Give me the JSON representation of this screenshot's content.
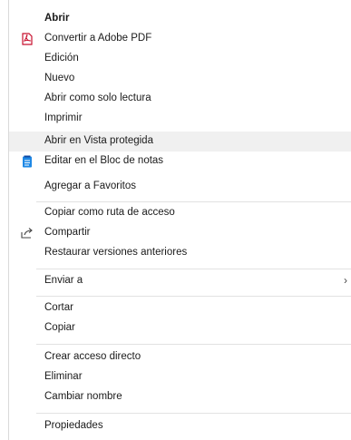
{
  "menu": {
    "items": [
      {
        "label": "Abrir",
        "bold": true
      },
      {
        "label": "Convertir a Adobe PDF",
        "icon": "pdf-icon"
      },
      {
        "label": "Edición"
      },
      {
        "label": "Nuevo"
      },
      {
        "label": "Abrir como solo lectura"
      },
      {
        "label": "Imprimir"
      },
      {
        "label": "Abrir en Vista protegida",
        "highlighted": true
      },
      {
        "label": "Editar en el Bloc de notas",
        "icon": "notepad-icon"
      },
      {
        "label": "Agregar a Favoritos"
      },
      {
        "label": "Copiar como ruta de acceso"
      },
      {
        "label": "Compartir",
        "icon": "share-icon"
      },
      {
        "label": "Restaurar versiones anteriores"
      },
      {
        "label": "Enviar a",
        "submenu": true
      },
      {
        "label": "Cortar"
      },
      {
        "label": "Copiar"
      },
      {
        "label": "Crear acceso directo"
      },
      {
        "label": "Eliminar"
      },
      {
        "label": "Cambiar nombre"
      },
      {
        "label": "Propiedades"
      }
    ],
    "submenu_arrow": "›"
  },
  "colors": {
    "hover_bg": "#f0f0f0",
    "separator": "#e2e2e2",
    "pdf_red": "#c8102e",
    "notepad_blue": "#1e88e5"
  }
}
